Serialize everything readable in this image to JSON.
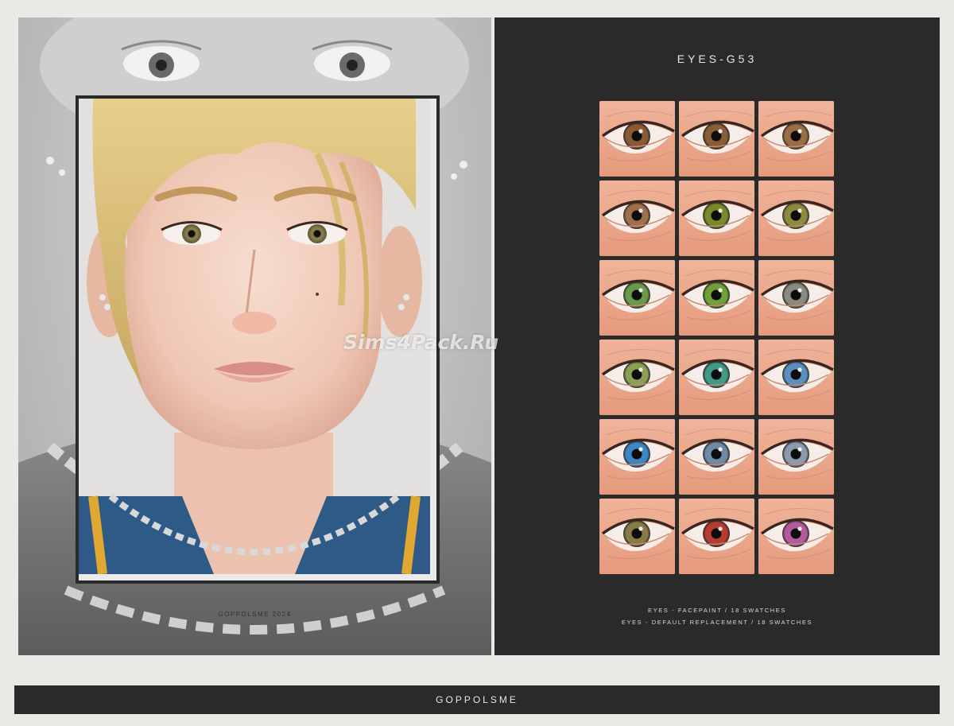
{
  "title": "EYES-G53",
  "credit": "GOPPOLSME 2024",
  "footer_brand": "GOPPOLSME",
  "info_lines": [
    "EYES - FACEPAINT / 18 SWATCHES",
    "EYES - DEFAULT REPLACEMENT / 18 SWATCHES"
  ],
  "watermark": "Sims4Pack.Ru",
  "swatches": [
    {
      "color": "#8a5a36"
    },
    {
      "color": "#8a5d35"
    },
    {
      "color": "#9a6d45"
    },
    {
      "color": "#a0704a"
    },
    {
      "color": "#7a8a2a"
    },
    {
      "color": "#8c8a3c"
    },
    {
      "color": "#6a9a48"
    },
    {
      "color": "#6fa03a"
    },
    {
      "color": "#8a8a7e"
    },
    {
      "color": "#8aa052"
    },
    {
      "color": "#3f9a86"
    },
    {
      "color": "#5a8fc0"
    },
    {
      "color": "#3d86c4"
    },
    {
      "color": "#6e8aa6"
    },
    {
      "color": "#8c9aae"
    },
    {
      "color": "#8a7a48"
    },
    {
      "color": "#b83a30"
    },
    {
      "color": "#b65aa0"
    }
  ]
}
